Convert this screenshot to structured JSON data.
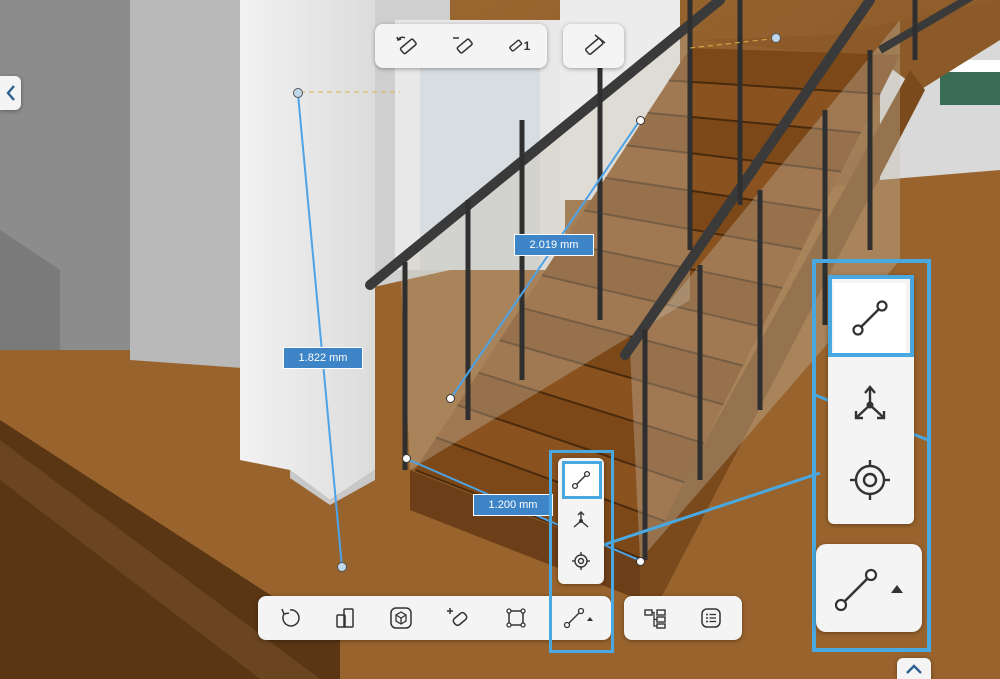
{
  "measurements": {
    "vertical": "1.822 mm",
    "diagonal": "2.019 mm",
    "horizontal": "1.200 mm"
  },
  "top_toolbar": {
    "undo_icon": "ruler-undo-icon",
    "clear_icon": "ruler-remove-icon",
    "count_icon": "ruler-count-icon",
    "count_value": "1",
    "toggle_icon": "ruler-hide-icon"
  },
  "bottom_toolbar": {
    "tools": [
      "rotate-icon",
      "split-view-icon",
      "3d-view-icon",
      "add-object-icon",
      "select-frame-icon",
      "measure-line-icon"
    ],
    "right_tools": [
      "hierarchy-icon",
      "list-icon"
    ]
  },
  "measure_menu": {
    "options": [
      "measure-line-icon",
      "axis-measure-icon",
      "snap-target-icon"
    ]
  },
  "colors": {
    "accent": "#3d85c6",
    "highlight": "#4aa8e0",
    "panel": "#f4f4f4"
  }
}
